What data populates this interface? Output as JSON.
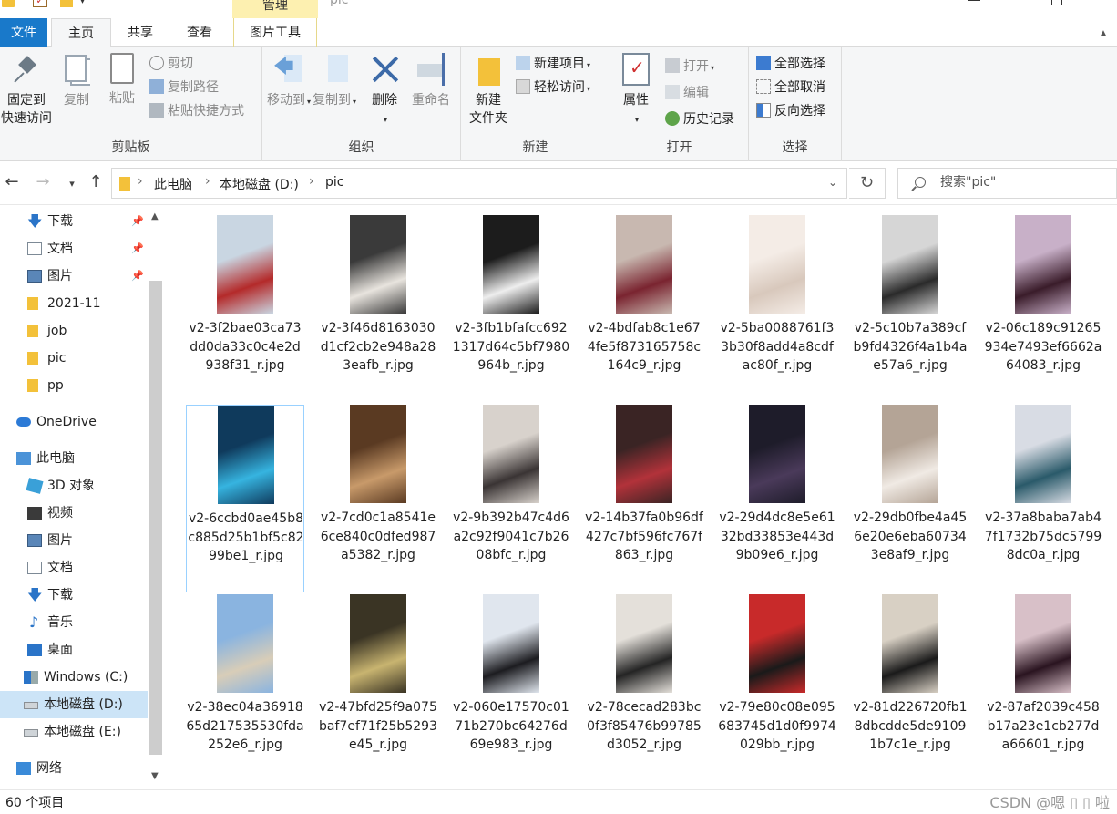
{
  "window": {
    "title": "pic",
    "context_tab_header": "管理"
  },
  "tabs": {
    "file": "文件",
    "home": "主页",
    "share": "共享",
    "view": "查看",
    "picture_tools": "图片工具"
  },
  "ribbon": {
    "clipboard": {
      "label": "剪贴板",
      "pin_line1": "固定到",
      "pin_line2": "快速访问",
      "copy": "复制",
      "paste": "粘贴",
      "cut": "剪切",
      "copy_path": "复制路径",
      "paste_shortcut": "粘贴快捷方式"
    },
    "organize": {
      "label": "组织",
      "move_to": "移动到",
      "copy_to": "复制到",
      "delete": "删除",
      "rename": "重命名"
    },
    "new": {
      "label": "新建",
      "new_folder_line1": "新建",
      "new_folder_line2": "文件夹",
      "new_item": "新建项目",
      "easy_access": "轻松访问"
    },
    "open": {
      "label": "打开",
      "properties": "属性",
      "open": "打开",
      "edit": "编辑",
      "history": "历史记录"
    },
    "select": {
      "label": "选择",
      "select_all": "全部选择",
      "select_none": "全部取消",
      "invert": "反向选择"
    }
  },
  "address": {
    "crumbs": [
      "此电脑",
      "本地磁盘 (D:)",
      "pic"
    ],
    "search_placeholder": "搜索\"pic\""
  },
  "nav": {
    "items": [
      {
        "label": "下载",
        "icon": "download-icon",
        "pinned": true
      },
      {
        "label": "文档",
        "icon": "document-icon",
        "pinned": true
      },
      {
        "label": "图片",
        "icon": "picture-icon",
        "pinned": true
      },
      {
        "label": "2021-11",
        "icon": "folder-icon",
        "pinned": false
      },
      {
        "label": "job",
        "icon": "folder-icon",
        "pinned": false
      },
      {
        "label": "pic",
        "icon": "folder-icon",
        "pinned": false
      },
      {
        "label": "pp",
        "icon": "folder-icon",
        "pinned": false
      },
      {
        "label": "OneDrive",
        "icon": "cloud-icon",
        "pinned": false
      },
      {
        "label": "此电脑",
        "icon": "computer-icon",
        "pinned": false
      },
      {
        "label": "3D 对象",
        "icon": "3d-objects-icon",
        "pinned": false
      },
      {
        "label": "视频",
        "icon": "video-icon",
        "pinned": false
      },
      {
        "label": "图片",
        "icon": "picture-icon",
        "pinned": false
      },
      {
        "label": "文档",
        "icon": "document-icon",
        "pinned": false
      },
      {
        "label": "下载",
        "icon": "download-icon",
        "pinned": false
      },
      {
        "label": "音乐",
        "icon": "music-icon",
        "pinned": false
      },
      {
        "label": "桌面",
        "icon": "desktop-icon",
        "pinned": false
      },
      {
        "label": "Windows (C:)",
        "icon": "windows-drive-icon",
        "pinned": false
      },
      {
        "label": "本地磁盘 (D:)",
        "icon": "drive-icon",
        "pinned": false
      },
      {
        "label": "本地磁盘 (E:)",
        "icon": "drive-icon",
        "pinned": false
      },
      {
        "label": "网络",
        "icon": "network-icon",
        "pinned": false
      }
    ],
    "selected_index": 17
  },
  "files": [
    {
      "name": "v2-3f2bae03ca73dd0da33c0c4e2d938f31_r.jpg",
      "colors": [
        "#c9d6e2",
        "#b42a2a"
      ]
    },
    {
      "name": "v2-3f46d8163030d1cf2cb2e948a283eafb_r.jpg",
      "colors": [
        "#3a3a3a",
        "#e8e4de"
      ]
    },
    {
      "name": "v2-3fb1bfafcc6921317d64c5bf7980964b_r.jpg",
      "colors": [
        "#1c1c1c",
        "#eeeeee"
      ]
    },
    {
      "name": "v2-4bdfab8c1e674fe5f873165758c164c9_r.jpg",
      "colors": [
        "#c8b8b0",
        "#7a2430"
      ]
    },
    {
      "name": "v2-5ba0088761f33b30f8add4a8cdfac80f_r.jpg",
      "colors": [
        "#f4ece6",
        "#d8c8bc"
      ]
    },
    {
      "name": "v2-5c10b7a389cfb9fd4326f4a1b4ae57a6_r.jpg",
      "colors": [
        "#d6d6d6",
        "#2a2a2a"
      ]
    },
    {
      "name": "v2-06c189c91265934e7493ef6662a64083_r.jpg",
      "colors": [
        "#c8b0c8",
        "#3a1c2a"
      ]
    },
    {
      "name": "v2-6ccbd0ae45b8c885d25b1bf5c8299be1_r.jpg",
      "colors": [
        "#0f3a5c",
        "#36b4e0"
      ]
    },
    {
      "name": "v2-7cd0c1a8541e6ce840c0dfed987a5382_r.jpg",
      "colors": [
        "#5a3a22",
        "#c89a6a"
      ]
    },
    {
      "name": "v2-9b392b47c4d6a2c92f9041c7b2608bfc_r.jpg",
      "colors": [
        "#d8d2cc",
        "#3a3434"
      ]
    },
    {
      "name": "v2-14b37fa0b96df427c7bf596fc767f863_r.jpg",
      "colors": [
        "#3a2424",
        "#b2323a"
      ]
    },
    {
      "name": "v2-29d4dc8e5e6132bd33853e443d9b09e6_r.jpg",
      "colors": [
        "#1e1c2a",
        "#4a3a5a"
      ]
    },
    {
      "name": "v2-29db0fbe4a456e20e6eba607343e8af9_r.jpg",
      "colors": [
        "#b4a496",
        "#f0eae4"
      ]
    },
    {
      "name": "v2-37a8baba7ab47f1732b75dc57998dc0a_r.jpg",
      "colors": [
        "#d8dce4",
        "#2a5a6a"
      ]
    },
    {
      "name": "v2-38ec04a3691865d217535530fda252e6_r.jpg",
      "colors": [
        "#8ab4e0",
        "#d8cdb8"
      ]
    },
    {
      "name": "v2-47bfd25f9a075baf7ef71f25b5293e45_r.jpg",
      "colors": [
        "#3a3424",
        "#c8b470"
      ]
    },
    {
      "name": "v2-060e17570c0171b270bc64276d69e983_r.jpg",
      "colors": [
        "#e0e6ee",
        "#1c1c20"
      ]
    },
    {
      "name": "v2-78cecad283bc0f3f85476b99785d3052_r.jpg",
      "colors": [
        "#e4e0da",
        "#242424"
      ]
    },
    {
      "name": "v2-79e80c08e095683745d1d0f9974029bb_r.jpg",
      "colors": [
        "#c82a2a",
        "#1a1a1a"
      ]
    },
    {
      "name": "v2-81d226720fb18dbcdde5de91091b7c1e_r.jpg",
      "colors": [
        "#d8d0c4",
        "#1a1a1a"
      ]
    },
    {
      "name": "v2-87af2039c458b17a23e1cb277da66601_r.jpg",
      "colors": [
        "#d8c0c8",
        "#2a1420"
      ]
    }
  ],
  "selected_file_index": 7,
  "status": {
    "item_count": "60 个项目",
    "watermark": "CSDN @嗯 ▯ ▯ 啦"
  }
}
